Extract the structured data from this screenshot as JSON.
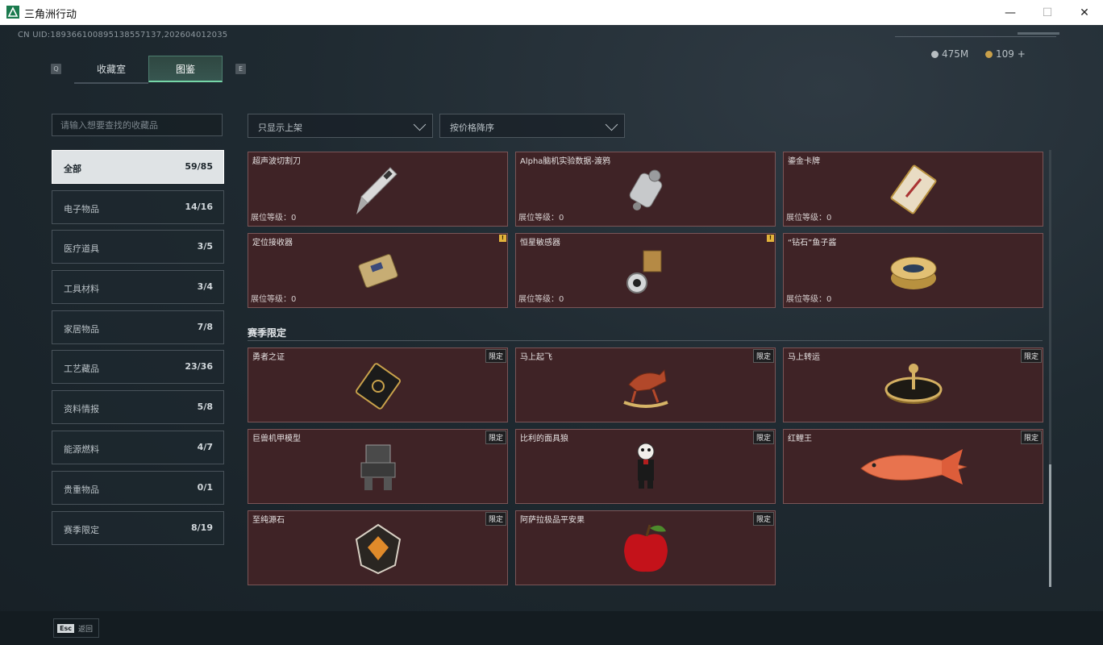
{
  "window": {
    "title": "三角洲行动",
    "minimize": "—",
    "maximize": "☐",
    "close": "✕"
  },
  "header": {
    "uid": "CN UID:1893661008951385571​37,202604012035",
    "currency1": "475M",
    "currency2": "109 +",
    "key_left": "Q",
    "key_right": "E"
  },
  "tabs": [
    {
      "label": "收藏室"
    },
    {
      "label": "图鉴"
    }
  ],
  "search": {
    "placeholder": "请输入想要查找的收藏品"
  },
  "categories": [
    {
      "label": "全部",
      "count": "59/85"
    },
    {
      "label": "电子物品",
      "count": "14/16"
    },
    {
      "label": "医疗道具",
      "count": "3/5"
    },
    {
      "label": "工具材料",
      "count": "3/4"
    },
    {
      "label": "家居物品",
      "count": "7/8"
    },
    {
      "label": "工艺藏品",
      "count": "23/36"
    },
    {
      "label": "资料情报",
      "count": "5/8"
    },
    {
      "label": "能源燃料",
      "count": "4/7"
    },
    {
      "label": "贵重物品",
      "count": "0/1"
    },
    {
      "label": "赛季限定",
      "count": "8/19"
    }
  ],
  "filters": {
    "shelf": "只显示上架",
    "sort": "按价格降序"
  },
  "items": [
    {
      "name": "超声波切割刀",
      "level": "展位等级：0",
      "icon": "knife-icon"
    },
    {
      "name": "Alpha脑机实验数据-渡鸦",
      "level": "展位等级：0",
      "icon": "data-device-icon"
    },
    {
      "name": "鎏金卡牌",
      "level": "展位等级：0",
      "icon": "card-icon"
    },
    {
      "name": "定位接收器",
      "level": "展位等级：0",
      "icon": "receiver-icon",
      "warn": "!"
    },
    {
      "name": "恒星敏感器",
      "level": "展位等级：0",
      "icon": "sensor-icon",
      "warn": "!"
    },
    {
      "name": "“钻石”鱼子酱",
      "level": "展位等级：0",
      "icon": "caviar-icon"
    }
  ],
  "season": {
    "title": "赛季限定",
    "limited_label": "限定",
    "items": [
      {
        "name": "勇者之证",
        "icon": "badge-card-icon"
      },
      {
        "name": "马上起飞",
        "icon": "rocking-horse-icon"
      },
      {
        "name": "马上转运",
        "icon": "horse-dial-icon"
      },
      {
        "name": "巨兽机甲模型",
        "icon": "mech-model-icon"
      },
      {
        "name": "比利的面具狼",
        "icon": "puppet-icon"
      },
      {
        "name": "红鲤王",
        "icon": "carp-icon"
      },
      {
        "name": "至纯源石",
        "icon": "gem-icon"
      },
      {
        "name": "阿萨拉极品平安果",
        "icon": "apple-icon"
      }
    ]
  },
  "footer": {
    "key": "Esc",
    "label": "返回"
  }
}
